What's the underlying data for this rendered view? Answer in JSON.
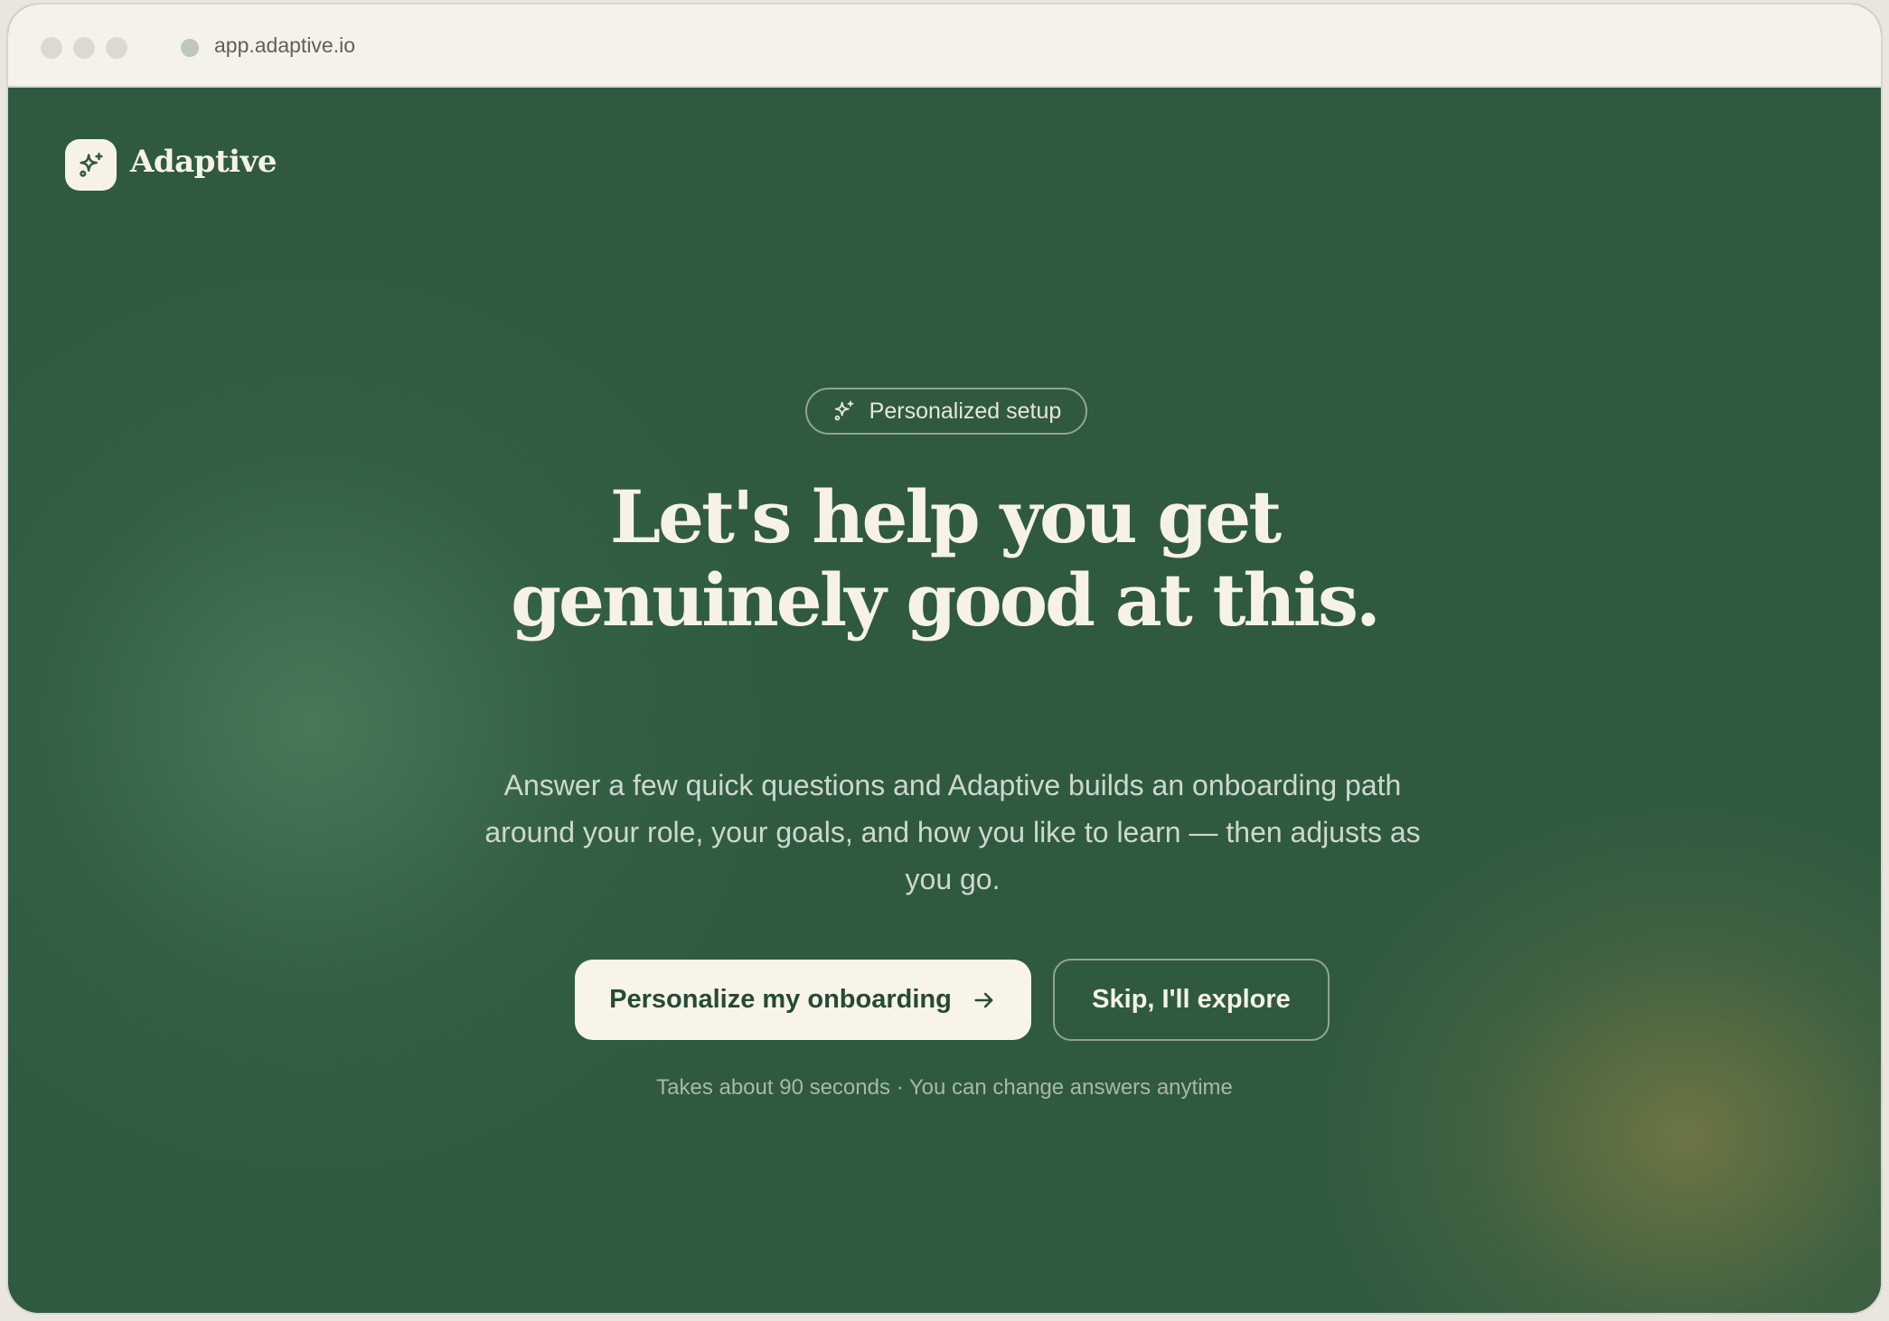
{
  "browser": {
    "url": "app.adaptive.io"
  },
  "brand": {
    "name": "Adaptive",
    "icon": "sparkle-icon"
  },
  "hero": {
    "badge": "Personalized setup",
    "badge_icon": "sparkle-icon",
    "headline_line1": "Let's help you get",
    "headline_line2": "genuinely good at this.",
    "subcopy": "Answer a few quick questions and Adaptive builds an onboarding path around your role, your goals, and how you like to learn — then adjusts as you go."
  },
  "actions": {
    "primary_label": "Personalize my onboarding",
    "primary_icon": "arrow-right-icon",
    "secondary_label": "Skip, I'll explore"
  },
  "footnote": "Takes about 90 seconds · You can change answers anytime",
  "colors": {
    "background": "#2f5a40",
    "cream": "#f6f2e8",
    "primary_text": "#264a33"
  }
}
